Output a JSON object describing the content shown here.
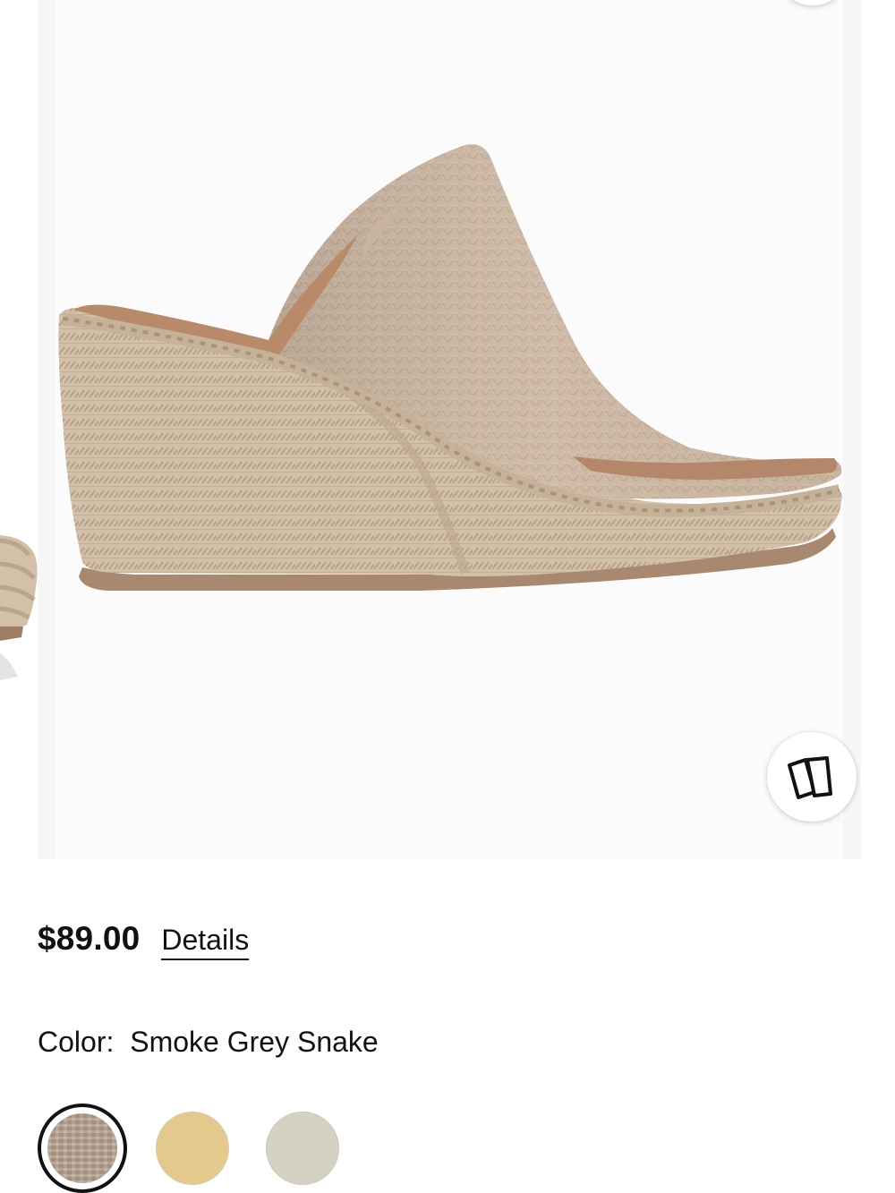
{
  "product": {
    "price": "$89.00",
    "details_label": "Details",
    "color_label": "Color:",
    "color_value": "Smoke Grey Snake"
  },
  "gallery": {
    "view_similar_icon": "cards-icon"
  },
  "swatches": [
    {
      "name": "smoke-grey-snake",
      "color": "#b6a18f",
      "selected": true
    },
    {
      "name": "swatch-2",
      "color": "#e3c98b",
      "selected": false
    },
    {
      "name": "swatch-3",
      "color": "#d6d2c3",
      "selected": false
    }
  ],
  "colors": {
    "text": "#111111",
    "image_background": "#f6f6f6",
    "shoe_upper": "#cdb8a3",
    "shoe_jute": "#d3c0a9",
    "shoe_sole": "#a8896f"
  }
}
